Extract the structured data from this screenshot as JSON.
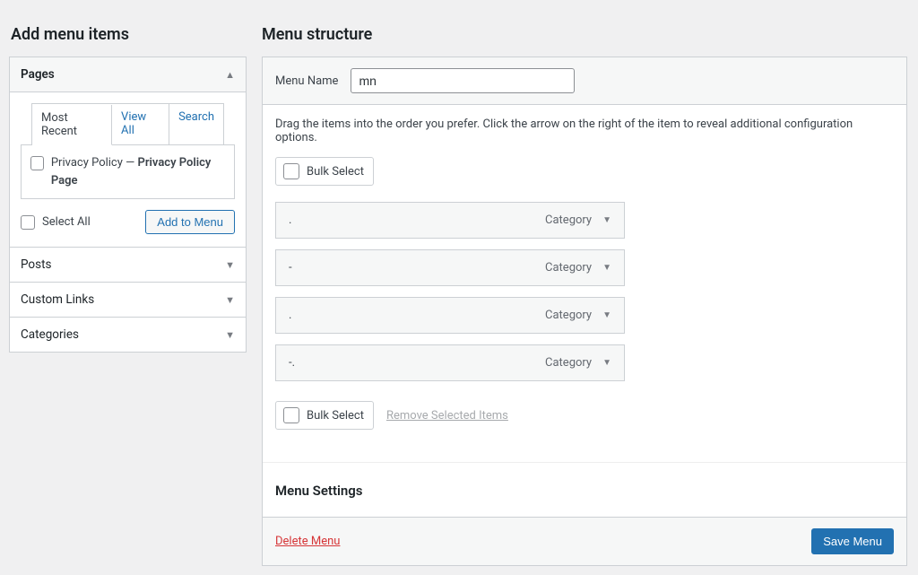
{
  "left": {
    "title": "Add menu items",
    "accordion": {
      "pages": {
        "label": "Pages",
        "expanded": true,
        "tabs": {
          "recent": "Most Recent",
          "view_all": "View All",
          "search": "Search"
        },
        "items": [
          {
            "title": "Privacy Policy",
            "sep": " — ",
            "subtitle": "Privacy Policy Page"
          }
        ],
        "select_all": "Select All",
        "add_button": "Add to Menu"
      },
      "posts": {
        "label": "Posts",
        "expanded": false
      },
      "custom_links": {
        "label": "Custom Links",
        "expanded": false
      },
      "categories": {
        "label": "Categories",
        "expanded": false
      }
    }
  },
  "right": {
    "title": "Menu structure",
    "menu_name_label": "Menu Name",
    "menu_name_value": "mn",
    "help": "Drag the items into the order you prefer. Click the arrow on the right of the item to reveal additional configuration options.",
    "bulk_select_label": "Bulk Select",
    "menu_items": [
      {
        "label": ".",
        "type": "Category"
      },
      {
        "label": "-",
        "type": "Category"
      },
      {
        "label": ".",
        "type": "Category"
      },
      {
        "label": "-.",
        "type": "Category"
      }
    ],
    "remove_selected_label": "Remove Selected Items",
    "settings_heading": "Menu Settings",
    "delete_label": "Delete Menu",
    "save_label": "Save Menu"
  }
}
